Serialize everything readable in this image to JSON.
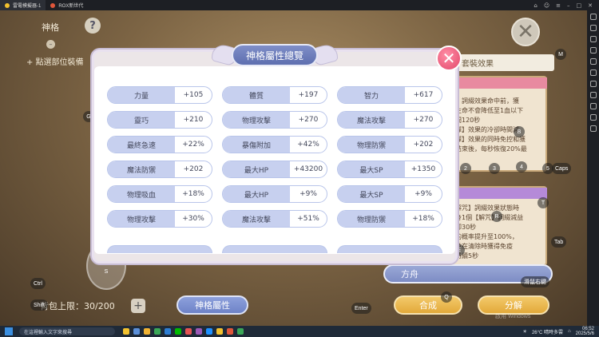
{
  "titlebar": {
    "tabs": [
      "雷電模擬器-1",
      "ROX新世代"
    ]
  },
  "game": {
    "header_title": "神格",
    "help_glyph": "?",
    "equip_hint": "點選部位裝備",
    "close_glyph": "✕",
    "equip_effect_label": "套裝效果",
    "right_panel_text": "】詞綴效果命中前，獲\n生命不會降低至1血以下\n間120秒\n彈】效果的冷卻時間減\n彈】效果的同時免控和獲\n結束後，每秒恢復20%最",
    "right_panel2_text": "解咒】詞綴效果狀態時\n身1個【解咒】詞綴減益\n卻30秒\n的概率提升至100%，\n並在清除時獲得免疫\n持續5秒",
    "direction_label": "方舟",
    "bag_label": "背包上限：30/200",
    "bag_plus": "+",
    "attr_button": "神格屬性",
    "craft_button": "合成",
    "split_button": "分解",
    "watermark": "啟用 Windows"
  },
  "keys": {
    "G": "G",
    "M": "M",
    "B": "B",
    "F": "F",
    "one": "1",
    "two": "2",
    "three": "3",
    "four": "4",
    "five": "5",
    "caps": "Caps",
    "T": "T",
    "R": "R",
    "tab": "Tab",
    "V": "V",
    "C": "C",
    "E": "E",
    "Q": "Q",
    "enter": "Enter",
    "ctrl": "Ctrl",
    "shift": "Shift",
    "W": "W",
    "S": "S",
    "D": "D",
    "scroll": "滑鼠右鍵"
  },
  "modal": {
    "title": "神格屬性總覽",
    "close_glyph": "✕",
    "rows": [
      [
        {
          "label": "力量",
          "value": "+105"
        },
        {
          "label": "體質",
          "value": "+197"
        },
        {
          "label": "智力",
          "value": "+617"
        }
      ],
      [
        {
          "label": "靈巧",
          "value": "+210"
        },
        {
          "label": "物理攻擊",
          "value": "+270"
        },
        {
          "label": "魔法攻擊",
          "value": "+270"
        }
      ],
      [
        {
          "label": "最終急速",
          "value": "+22%"
        },
        {
          "label": "暴傷附加",
          "value": "+42%"
        },
        {
          "label": "物理防禦",
          "value": "+202"
        }
      ],
      [
        {
          "label": "魔法防禦",
          "value": "+202"
        },
        {
          "label": "最大HP",
          "value": "+43200"
        },
        {
          "label": "最大SP",
          "value": "+1350"
        }
      ],
      [
        {
          "label": "物理吸血",
          "value": "+18%"
        },
        {
          "label": "最大HP",
          "value": "+9%"
        },
        {
          "label": "最大SP",
          "value": "+9%"
        }
      ],
      [
        {
          "label": "物理攻擊",
          "value": "+30%"
        },
        {
          "label": "魔法攻擊",
          "value": "+51%"
        },
        {
          "label": "物理防禦",
          "value": "+18%"
        }
      ]
    ]
  },
  "taskbar": {
    "search_placeholder": "在這裡輸入文字來搜尋",
    "weather": "26°C 晴時多雲",
    "time": "06:52",
    "date": "2025/5/6"
  },
  "colors": {
    "accent": "#7f8ec8",
    "label_bg": "#c7d0ef",
    "close": "#e2476a"
  }
}
